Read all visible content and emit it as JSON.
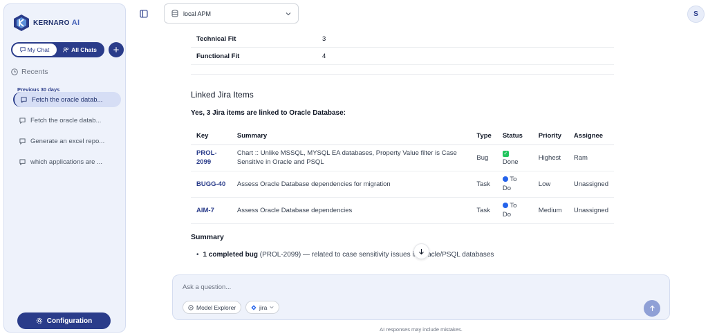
{
  "app": {
    "logo_text": "KERNARO",
    "logo_suffix": "AI",
    "brand_color": "#2a3c8a"
  },
  "sidebar": {
    "my_chat_label": "My Chat",
    "all_chats_label": "All Chats",
    "recents_label": "Recents",
    "period_label": "Previous 30 days",
    "chats": [
      {
        "label": "Fetch the oracle datab...",
        "active": true
      },
      {
        "label": "Fetch the oracle datab...",
        "active": false
      },
      {
        "label": "Generate an excel repo...",
        "active": false
      },
      {
        "label": "which applications are ...",
        "active": false
      }
    ],
    "config_label": "Configuration"
  },
  "header": {
    "db_label": "local APM",
    "avatar_initial": "S"
  },
  "content": {
    "fit_rows": [
      {
        "key": "Technical Fit",
        "value": "3"
      },
      {
        "key": "Functional Fit",
        "value": "4"
      }
    ],
    "linked_heading": "Linked Jira Items",
    "linked_subheading": "Yes, 3 Jira items are linked to Oracle Database:",
    "table_headers": [
      "Key",
      "Summary",
      "Type",
      "Status",
      "Priority",
      "Assignee"
    ],
    "rows": [
      {
        "key_a": "PROL-",
        "key_b": "2099",
        "summary_a": "Chart :: Unlike MSSQL, MYSQL EA databases, Property Value filter is Case",
        "summary_b": "Sensitive in Oracle and PSQL",
        "type": "Bug",
        "status_a": "",
        "status_b": "Done",
        "status_icon": "check-box",
        "priority": "Highest",
        "assignee": "Ram"
      },
      {
        "key_a": "BUGG-40",
        "key_b": "",
        "summary_a": "Assess Oracle Database dependencies for migration",
        "summary_b": "",
        "type": "Task",
        "status_a": "To",
        "status_b": "Do",
        "status_icon": "blue-circle",
        "priority": "Low",
        "assignee": "Unassigned"
      },
      {
        "key_a": "AIM-7",
        "key_b": "",
        "summary_a": "Assess Oracle Database dependencies",
        "summary_b": "",
        "type": "Task",
        "status_a": "To",
        "status_b": "Do",
        "status_icon": "blue-circle",
        "priority": "Medium",
        "assignee": "Unassigned"
      }
    ],
    "summary_heading": "Summary",
    "summary_bold": "1 completed bug",
    "summary_rest": "(PROL-2099) — related to case sensitivity issues in Oracle/PSQL databases"
  },
  "composer": {
    "placeholder": "Ask a question...",
    "chip_model_explorer": "Model Explorer",
    "chip_jira": "jira",
    "disclaimer": "AI responses may include mistakes."
  }
}
